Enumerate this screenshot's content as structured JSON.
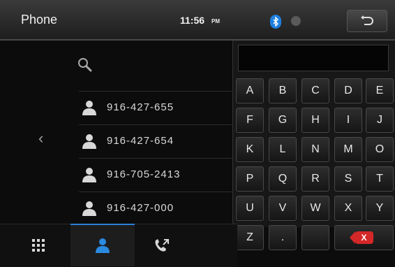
{
  "header": {
    "title": "Phone",
    "time": "11:56",
    "ampm": "PM"
  },
  "icons": {
    "bluetooth": "bluetooth-icon",
    "status": "status-dot-icon",
    "back": "back-arrow-icon",
    "search": "search-icon",
    "prev": "chevron-left-icon",
    "contact": "contact-person-icon",
    "dialpad": "dialpad-icon",
    "recent_calls": "recent-calls-icon"
  },
  "colors": {
    "accent": "#2a7fd5",
    "bluetooth": "#1e7fe0",
    "delete": "#d42828"
  },
  "contacts": [
    {
      "number": "916-427-655"
    },
    {
      "number": "916-427-654"
    },
    {
      "number": "916-705-2413"
    },
    {
      "number": "916-427-000"
    }
  ],
  "keypad": {
    "input_value": "",
    "keys": [
      "A",
      "B",
      "C",
      "D",
      "E",
      "F",
      "G",
      "H",
      "I",
      "J",
      "K",
      "L",
      "N",
      "M",
      "O",
      "P",
      "Q",
      "R",
      "S",
      "T",
      "U",
      "V",
      "W",
      "X",
      "Y",
      "Z",
      ".",
      ""
    ],
    "delete_label": "X"
  },
  "prev_label": "‹"
}
